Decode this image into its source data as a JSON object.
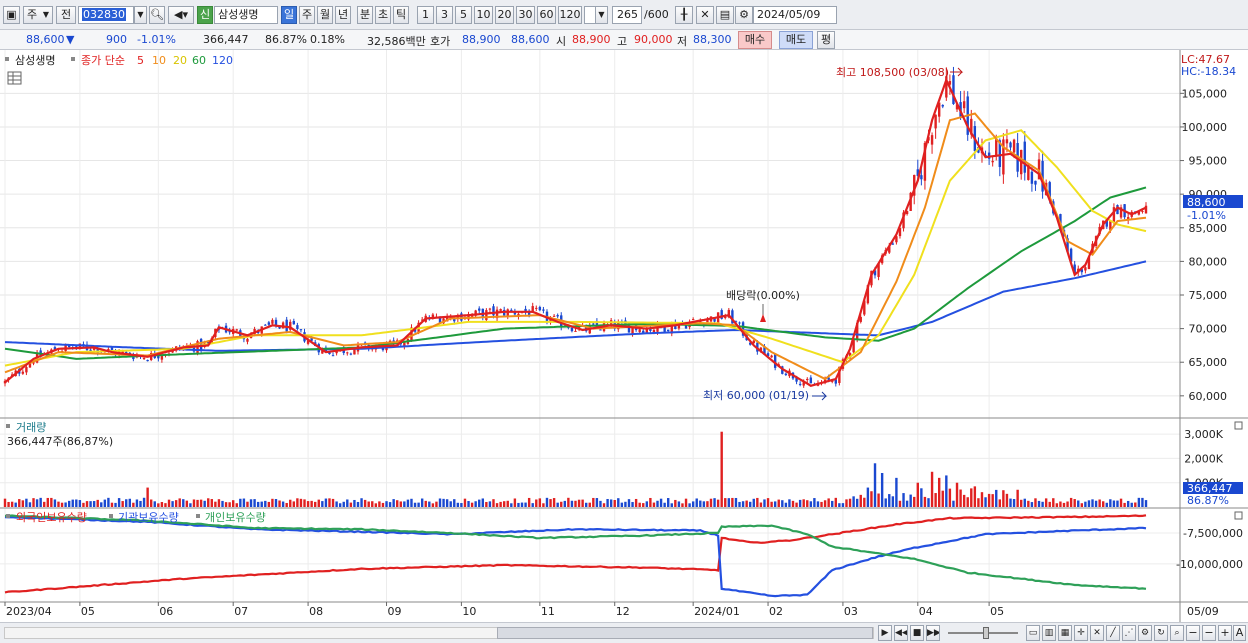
{
  "toolbar": {
    "market": "주",
    "all": "전",
    "code": "032830",
    "badge": "신",
    "name": "삼성생명",
    "periods": [
      "일",
      "주",
      "월",
      "년",
      "분",
      "초",
      "틱"
    ],
    "active_period": "일",
    "nums": [
      "1",
      "3",
      "5",
      "10",
      "20",
      "30",
      "60",
      "120"
    ],
    "count": "265",
    "count_total": "/600",
    "date": "2024/05/09"
  },
  "quote": {
    "price": "88,600",
    "arrow": "▼",
    "change": "900",
    "change_pct": "-1.01%",
    "volume": "366,447",
    "vol_ratio": "86.87%",
    "turnover": "0.18%",
    "amount": "32,586백만",
    "hoga_label": "호가",
    "ask": "88,900",
    "bid": "88,600",
    "open_label": "시",
    "open": "88,900",
    "high_label": "고",
    "high": "90,000",
    "low_label": "저",
    "low": "88,300",
    "buy": "매수",
    "sell": "매도",
    "eval": "평"
  },
  "colors": {
    "up": "#e02020",
    "down": "#1a48d0",
    "ma5": "#e02020",
    "ma10": "#f08c1a",
    "ma20": "#f0e01e",
    "ma60": "#1e9a3c",
    "ma120": "#2450e0",
    "foreign": "#e02020",
    "institution": "#2450e0",
    "individual": "#2ea058"
  },
  "chart_data": [
    {
      "type": "candlestick",
      "title": "삼성생명",
      "legend": {
        "label": "종가 단순",
        "periods": [
          "5",
          "10",
          "20",
          "60",
          "120"
        ]
      },
      "y_ticks": [
        "105,000",
        "100,000",
        "95,000",
        "90,000",
        "85,000",
        "80,000",
        "75,000",
        "70,000",
        "65,000",
        "60,000"
      ],
      "ylim": [
        57000,
        111000
      ],
      "side_labels": {
        "lc": "LC:47.67",
        "hc": "HC:-18.34",
        "last": "88,600",
        "last_pct": "-1.01%"
      },
      "x_ticks": [
        "2023/04",
        "05",
        "06",
        "07",
        "08",
        "09",
        "10",
        "11",
        "12",
        "2024/01",
        "02",
        "03",
        "04",
        "05",
        "05/09"
      ],
      "annotations": {
        "high": "최고 108,500 (03/08)",
        "low": "최저 60,000 (01/19)",
        "dividend": "배당락(0.00%)"
      },
      "ma_anchors": {
        "ma5": [
          [
            0,
            62000
          ],
          [
            8,
            65500
          ],
          [
            15,
            67000
          ],
          [
            25,
            67200
          ],
          [
            30,
            66500
          ],
          [
            40,
            65800
          ],
          [
            50,
            67200
          ],
          [
            57,
            67500
          ],
          [
            60,
            70200
          ],
          [
            68,
            69000
          ],
          [
            75,
            70500
          ],
          [
            80,
            70200
          ],
          [
            90,
            66500
          ],
          [
            100,
            67200
          ],
          [
            110,
            67500
          ],
          [
            118,
            71500
          ],
          [
            130,
            72000
          ],
          [
            140,
            72500
          ],
          [
            148,
            72500
          ],
          [
            155,
            71000
          ],
          [
            162,
            69800
          ],
          [
            170,
            70500
          ],
          [
            180,
            70000
          ],
          [
            188,
            70500
          ],
          [
            195,
            71200
          ],
          [
            203,
            72000
          ],
          [
            210,
            67500
          ],
          [
            218,
            64000
          ],
          [
            226,
            61500
          ],
          [
            233,
            62500
          ],
          [
            237,
            67000
          ],
          [
            243,
            78000
          ],
          [
            250,
            84000
          ],
          [
            256,
            92000
          ],
          [
            260,
            101000
          ],
          [
            264,
            107000
          ],
          [
            270,
            100000
          ],
          [
            275,
            95500
          ],
          [
            282,
            96000
          ],
          [
            290,
            93000
          ],
          [
            295,
            86500
          ],
          [
            300,
            78000
          ],
          [
            303,
            79500
          ],
          [
            308,
            85500
          ],
          [
            312,
            88000
          ],
          [
            316,
            87000
          ],
          [
            320,
            88000
          ]
        ],
        "ma10": [
          [
            0,
            63500
          ],
          [
            15,
            66500
          ],
          [
            40,
            66000
          ],
          [
            60,
            68500
          ],
          [
            80,
            69500
          ],
          [
            95,
            67500
          ],
          [
            110,
            68000
          ],
          [
            125,
            71500
          ],
          [
            150,
            72000
          ],
          [
            165,
            70000
          ],
          [
            195,
            70800
          ],
          [
            205,
            70500
          ],
          [
            215,
            66500
          ],
          [
            230,
            62500
          ],
          [
            240,
            66500
          ],
          [
            250,
            77000
          ],
          [
            258,
            88000
          ],
          [
            265,
            101000
          ],
          [
            272,
            102000
          ],
          [
            280,
            97000
          ],
          [
            290,
            93500
          ],
          [
            298,
            83000
          ],
          [
            305,
            81000
          ],
          [
            312,
            86000
          ],
          [
            320,
            86500
          ]
        ],
        "ma20": [
          [
            0,
            64500
          ],
          [
            20,
            66500
          ],
          [
            50,
            67000
          ],
          [
            70,
            69000
          ],
          [
            100,
            69000
          ],
          [
            130,
            71000
          ],
          [
            160,
            71000
          ],
          [
            200,
            70800
          ],
          [
            215,
            68500
          ],
          [
            235,
            65000
          ],
          [
            245,
            69000
          ],
          [
            255,
            78000
          ],
          [
            265,
            92000
          ],
          [
            275,
            98000
          ],
          [
            285,
            99500
          ],
          [
            295,
            94000
          ],
          [
            305,
            87500
          ],
          [
            312,
            85500
          ],
          [
            320,
            84500
          ]
        ],
        "ma60": [
          [
            0,
            67000
          ],
          [
            20,
            65500
          ],
          [
            50,
            66200
          ],
          [
            100,
            67200
          ],
          [
            140,
            70000
          ],
          [
            180,
            70700
          ],
          [
            205,
            70400
          ],
          [
            230,
            68700
          ],
          [
            245,
            68200
          ],
          [
            255,
            70000
          ],
          [
            270,
            76000
          ],
          [
            285,
            81500
          ],
          [
            300,
            86000
          ],
          [
            310,
            89500
          ],
          [
            320,
            91000
          ]
        ],
        "ma120": [
          [
            0,
            68000
          ],
          [
            30,
            67300
          ],
          [
            60,
            66700
          ],
          [
            100,
            67000
          ],
          [
            140,
            68200
          ],
          [
            180,
            69300
          ],
          [
            205,
            69800
          ],
          [
            230,
            69300
          ],
          [
            245,
            69000
          ],
          [
            260,
            71000
          ],
          [
            280,
            75500
          ],
          [
            300,
            77500
          ],
          [
            320,
            80000
          ]
        ]
      }
    },
    {
      "type": "bar",
      "title": "거래량",
      "subtitle": "366,447주(86,87%)",
      "y_ticks": [
        "3,000K",
        "2,000K",
        "1,000K"
      ],
      "ylim": [
        0,
        3500000
      ],
      "last_label": "366,447",
      "last_pct": "86.87%",
      "spikes": [
        [
          40,
          800000
        ],
        [
          201,
          3100000
        ],
        [
          232,
          250000
        ],
        [
          240,
          500000
        ],
        [
          242,
          800000
        ],
        [
          244,
          1800000
        ],
        [
          246,
          1400000
        ],
        [
          250,
          1200000
        ],
        [
          256,
          1000000
        ],
        [
          260,
          1450000
        ],
        [
          262,
          1200000
        ],
        [
          264,
          1300000
        ],
        [
          267,
          1000000
        ],
        [
          272,
          850000
        ]
      ]
    },
    {
      "type": "line",
      "legend": [
        "외국인보유수량",
        "기관보유수량",
        "개인보유수량"
      ],
      "y_ticks": [
        "-7,500,000",
        "-10,000,000"
      ],
      "series": [
        {
          "name": "외국인보유수량",
          "anchors": [
            [
              0,
              -12300000
            ],
            [
              50,
              -11200000
            ],
            [
              100,
              -10400000
            ],
            [
              140,
              -10100000
            ],
            [
              180,
              -10300000
            ],
            [
              200,
              -10500000
            ],
            [
              201,
              -7900000
            ],
            [
              210,
              -8300000
            ],
            [
              220,
              -8100000
            ],
            [
              232,
              -7600000
            ],
            [
              250,
              -6800000
            ],
            [
              265,
              -6300000
            ],
            [
              300,
              -6200000
            ],
            [
              320,
              -6100000
            ]
          ]
        },
        {
          "name": "기관보유수량",
          "anchors": [
            [
              0,
              -6200000
            ],
            [
              40,
              -6600000
            ],
            [
              70,
              -7200000
            ],
            [
              100,
              -7400000
            ],
            [
              125,
              -7600000
            ],
            [
              160,
              -7200000
            ],
            [
              195,
              -7300000
            ],
            [
              200,
              -7700000
            ],
            [
              201,
              -12000000
            ],
            [
              215,
              -12600000
            ],
            [
              225,
              -12500000
            ],
            [
              232,
              -10500000
            ],
            [
              245,
              -9400000
            ],
            [
              255,
              -8700000
            ],
            [
              275,
              -7600000
            ],
            [
              300,
              -7300000
            ],
            [
              320,
              -7100000
            ]
          ]
        },
        {
          "name": "개인보유수량",
          "anchors": [
            [
              0,
              -6100000
            ],
            [
              40,
              -6500000
            ],
            [
              70,
              -7100000
            ],
            [
              100,
              -7200000
            ],
            [
              125,
              -7500000
            ],
            [
              150,
              -7900000
            ],
            [
              180,
              -7700000
            ],
            [
              200,
              -7500000
            ],
            [
              201,
              -7000000
            ],
            [
              215,
              -6900000
            ],
            [
              225,
              -7600000
            ],
            [
              232,
              -8600000
            ],
            [
              255,
              -9600000
            ],
            [
              270,
              -10700000
            ],
            [
              300,
              -11700000
            ],
            [
              320,
              -12000000
            ]
          ]
        }
      ]
    }
  ]
}
